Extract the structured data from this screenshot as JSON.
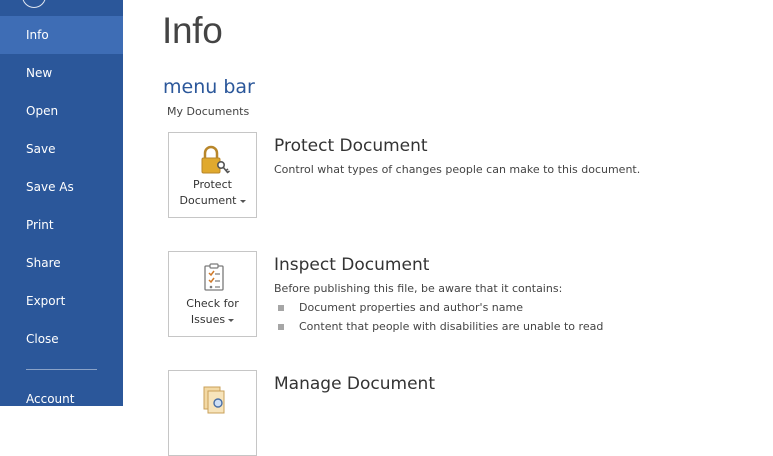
{
  "sidebar": {
    "items": [
      {
        "label": "Info",
        "active": true
      },
      {
        "label": "New"
      },
      {
        "label": "Open"
      },
      {
        "label": "Save"
      },
      {
        "label": "Save As"
      },
      {
        "label": "Print"
      },
      {
        "label": "Share"
      },
      {
        "label": "Export"
      },
      {
        "label": "Close"
      }
    ],
    "account": "Account"
  },
  "main": {
    "title": "Info",
    "doc_name": "menu bar",
    "doc_location": "My Documents",
    "protect": {
      "button_line1": "Protect",
      "button_line2": "Document",
      "title": "Protect Document",
      "desc": "Control what types of changes people can make to this document."
    },
    "inspect": {
      "button_line1": "Check for",
      "button_line2": "Issues",
      "title": "Inspect Document",
      "desc": "Before publishing this file, be aware that it contains:",
      "bullets": [
        "Document properties and author's name",
        "Content that people with disabilities are unable to read"
      ]
    },
    "manage": {
      "title": "Manage Document"
    }
  },
  "colors": {
    "sidebar_bg": "#2b579a",
    "sidebar_active": "#3e6db5",
    "accent": "#2b579a",
    "lock": "#e0a92e"
  },
  "icons": [
    "back-arrow-icon",
    "lock-key-icon",
    "inspect-checklist-icon",
    "manage-documents-icon"
  ]
}
